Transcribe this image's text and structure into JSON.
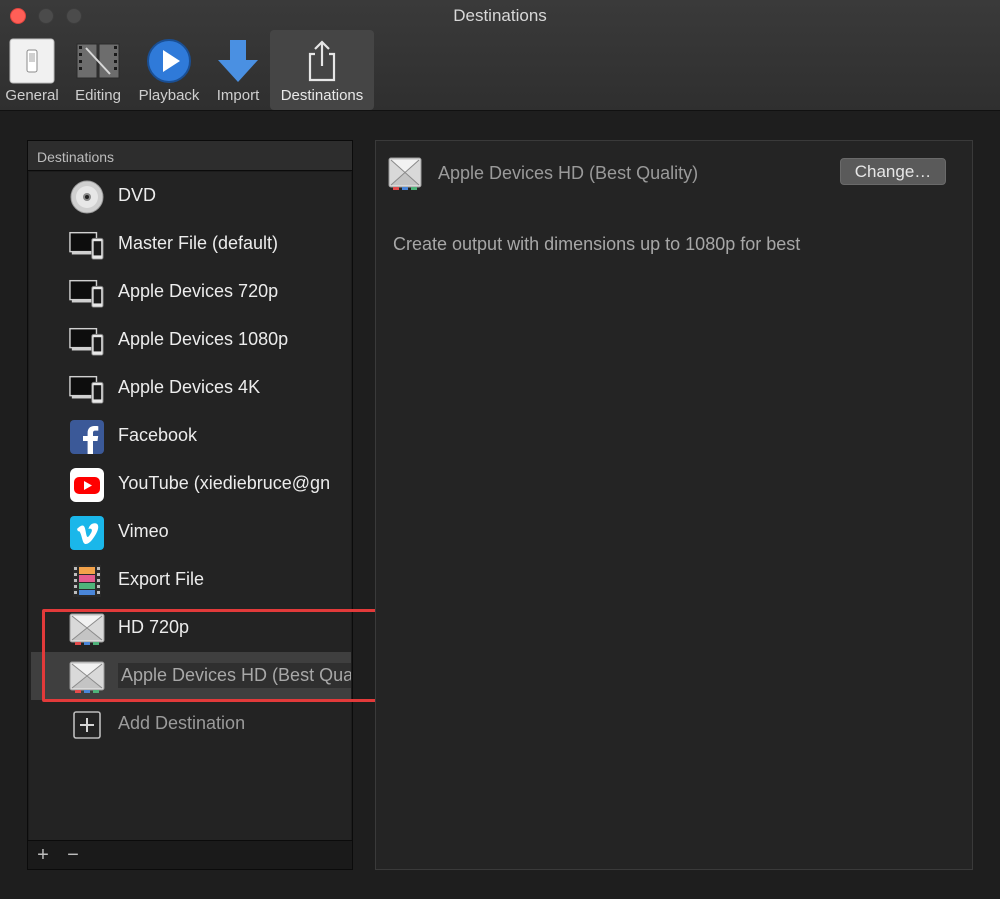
{
  "window": {
    "title": "Destinations"
  },
  "toolbar": {
    "items": [
      {
        "label": "General",
        "icon": "general-icon"
      },
      {
        "label": "Editing",
        "icon": "film-edit-icon"
      },
      {
        "label": "Playback",
        "icon": "play-icon"
      },
      {
        "label": "Import",
        "icon": "download-arrow-icon"
      },
      {
        "label": "Destinations",
        "icon": "share-icon",
        "selected": true
      }
    ]
  },
  "sidebar": {
    "header": "Destinations",
    "items": [
      {
        "label": "DVD",
        "icon": "dvd-icon"
      },
      {
        "label": "Master File (default)",
        "icon": "devices-icon"
      },
      {
        "label": "Apple Devices 720p",
        "icon": "devices-icon"
      },
      {
        "label": "Apple Devices 1080p",
        "icon": "devices-icon"
      },
      {
        "label": "Apple Devices 4K",
        "icon": "devices-icon"
      },
      {
        "label": "Facebook",
        "icon": "facebook-icon"
      },
      {
        "label": "YouTube (xiediebruce@gn",
        "icon": "youtube-icon"
      },
      {
        "label": "Vimeo",
        "icon": "vimeo-icon"
      },
      {
        "label": "Export File",
        "icon": "film-strip-icon"
      },
      {
        "label": "HD 720p",
        "icon": "compressor-icon"
      },
      {
        "label": "Apple Devices HD (Best Quality)",
        "icon": "compressor-icon",
        "selected": true
      },
      {
        "label": "Add Destination",
        "icon": "add-icon"
      }
    ],
    "footer": {
      "add_label": "+",
      "remove_label": "−"
    }
  },
  "detail": {
    "title": "Apple Devices HD (Best Quality)",
    "change_button": "Change…",
    "description": "Create output with dimensions up to 1080p for best"
  },
  "colors": {
    "background": "#1e1e1e",
    "accent_blue": "#2f7ad9",
    "highlight_red": "#e23a3a",
    "youtube_red": "#ff0000",
    "facebook_blue": "#3b5998",
    "vimeo_blue": "#1ab7ea"
  }
}
